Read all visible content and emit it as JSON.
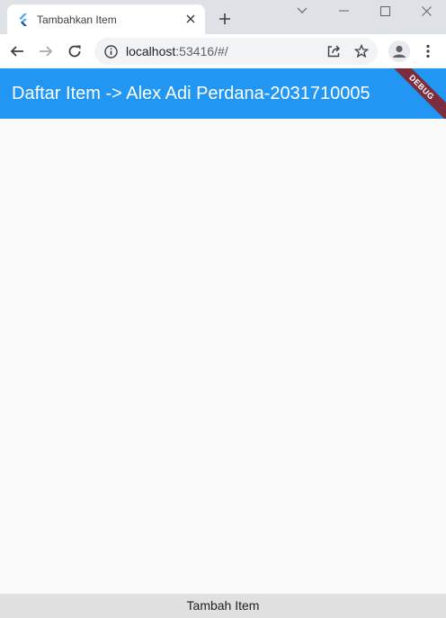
{
  "browser": {
    "tab": {
      "title": "Tambahkan Item",
      "favicon": "flutter-icon"
    },
    "address_bar": {
      "host": "localhost",
      "rest": ":53416/#/"
    },
    "icons": {
      "back": "arrow-left-icon",
      "forward": "arrow-right-icon",
      "reload": "reload-icon",
      "site_info": "info-icon",
      "share": "share-icon",
      "bookmark": "star-icon",
      "profile": "profile-avatar",
      "menu": "three-dots-icon"
    }
  },
  "app": {
    "appbar": {
      "title": "Daftar Item -> Alex Adi Perdana-2031710005",
      "color": "#2196f3"
    },
    "debug_banner": "DEBUG",
    "bottom_button": {
      "label": "Tambah Item"
    }
  },
  "colors": {
    "tabstrip": "#dee1e6",
    "appbar": "#2196f3",
    "background": "#fafafa",
    "bottom_button": "#e0e0e0",
    "debug_banner": "#7b2d3e"
  }
}
